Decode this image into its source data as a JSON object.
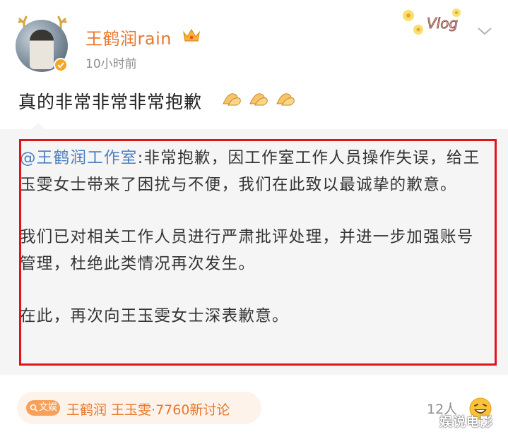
{
  "author": {
    "name": "王鹤润rain",
    "time": "10小时前",
    "verified_color": "#f6a623",
    "name_color": "#e8782e"
  },
  "post": {
    "text": "真的非常非常非常抱歉",
    "emojis": [
      "clap-hands-icon",
      "clap-hands-icon",
      "clap-hands-icon"
    ]
  },
  "repost": {
    "mention": "@王鹤润工作室",
    "paragraph1": ":非常抱歉，因工作室工作人员操作失误，给王玉雯女士带来了困扰与不便，我们在此致以最诚挚的歉意。",
    "paragraph2": "我们已对相关工作人员进行严肃批评处理，并进一步加强账号管理，杜绝此类情况再次发生。",
    "paragraph3": "在此，再次向王玉雯女士深表歉意。",
    "highlight_color": "#e0131b"
  },
  "topic": {
    "badge": "文娱",
    "text": "王鹤润 王玉雯·7760新讨论"
  },
  "reactions": {
    "count": "12人"
  },
  "watermark": {
    "text": "娱说电影"
  },
  "sticker": {
    "text": "Vlog"
  }
}
